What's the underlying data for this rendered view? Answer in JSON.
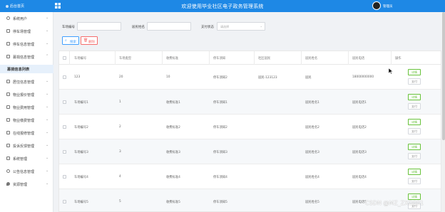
{
  "app": {
    "brand": "后台首页",
    "title": "欢迎使用毕业社区电子政务管理系统",
    "user": "管理员"
  },
  "sidebar": {
    "items": [
      {
        "label": "系统用户",
        "icon": "user-icon",
        "arrow": "⌄"
      },
      {
        "label": "停车场管理",
        "icon": "file-icon",
        "arrow": "⌄"
      },
      {
        "label": "停车信息管理",
        "icon": "file-icon",
        "arrow": "⌄"
      },
      {
        "label": "募捐信息管理",
        "icon": "file-icon",
        "arrow": "⌃"
      },
      {
        "label": "募捐信息列表",
        "icon": "",
        "arrow": ""
      },
      {
        "label": "居住信息管理",
        "icon": "file-icon",
        "arrow": "⌄"
      },
      {
        "label": "物业报价管理",
        "icon": "file-icon",
        "arrow": "⌄"
      },
      {
        "label": "物业费用管理",
        "icon": "file-icon",
        "arrow": "⌄"
      },
      {
        "label": "物业缴费管理",
        "icon": "file-icon",
        "arrow": "⌄"
      },
      {
        "label": "在线报修管理",
        "icon": "file-icon",
        "arrow": "⌄"
      },
      {
        "label": "投诉反馈管理",
        "icon": "file-icon",
        "arrow": "⌄"
      },
      {
        "label": "系统管理",
        "icon": "chart-icon",
        "arrow": "⌄"
      },
      {
        "label": "公告信息管理",
        "icon": "gear-icon",
        "arrow": "⌄"
      },
      {
        "label": "资源管理",
        "icon": "pin-icon",
        "arrow": "⌄"
      }
    ]
  },
  "filters": {
    "field1_label": "车场编号",
    "field2_label": "居民姓名",
    "field3_label": "支付状态",
    "field3_placeholder": "请选择",
    "search_label": "搜索",
    "delete_label": "删除"
  },
  "table": {
    "headers": [
      "车场编号",
      "车场类型",
      "收费标准",
      "停车须知",
      "社区居民",
      "居民姓名",
      "居民电话",
      "操作"
    ],
    "rows": [
      {
        "c1": "123",
        "c2": "20",
        "c3": "10",
        "c4": "停车须知2",
        "c5": "居民-123123",
        "c6": "居民",
        "c7": "18000000000"
      },
      {
        "c1": "车场编号1",
        "c2": "1",
        "c3": "收费标准1",
        "c4": "停车须知1",
        "c5": "",
        "c6": "居民姓名1",
        "c7": "居民电话1"
      },
      {
        "c1": "车场编号2",
        "c2": "2",
        "c3": "收费标准2",
        "c4": "停车须知2",
        "c5": "",
        "c6": "居民姓名2",
        "c7": "居民电话2"
      },
      {
        "c1": "车场编号3",
        "c2": "3",
        "c3": "收费标准3",
        "c4": "停车须知3",
        "c5": "",
        "c6": "居民姓名3",
        "c7": "居民电话3"
      },
      {
        "c1": "车场编号4",
        "c2": "4",
        "c3": "收费标准4",
        "c4": "停车须知4",
        "c5": "",
        "c6": "居民姓名4",
        "c7": "居民电话4"
      },
      {
        "c1": "车场编号5",
        "c2": "5",
        "c3": "收费标准5",
        "c4": "停车须知5",
        "c5": "",
        "c6": "居民姓名5",
        "c7": "居民电话5"
      }
    ],
    "detail_label": "详情",
    "pay_label": "支付"
  },
  "watermark": "CSDN @MZ_ZXD001",
  "colors": {
    "topbar": "#1e88e5",
    "primary": "#409eff",
    "danger": "#f56c6c",
    "success": "#67c23a"
  }
}
